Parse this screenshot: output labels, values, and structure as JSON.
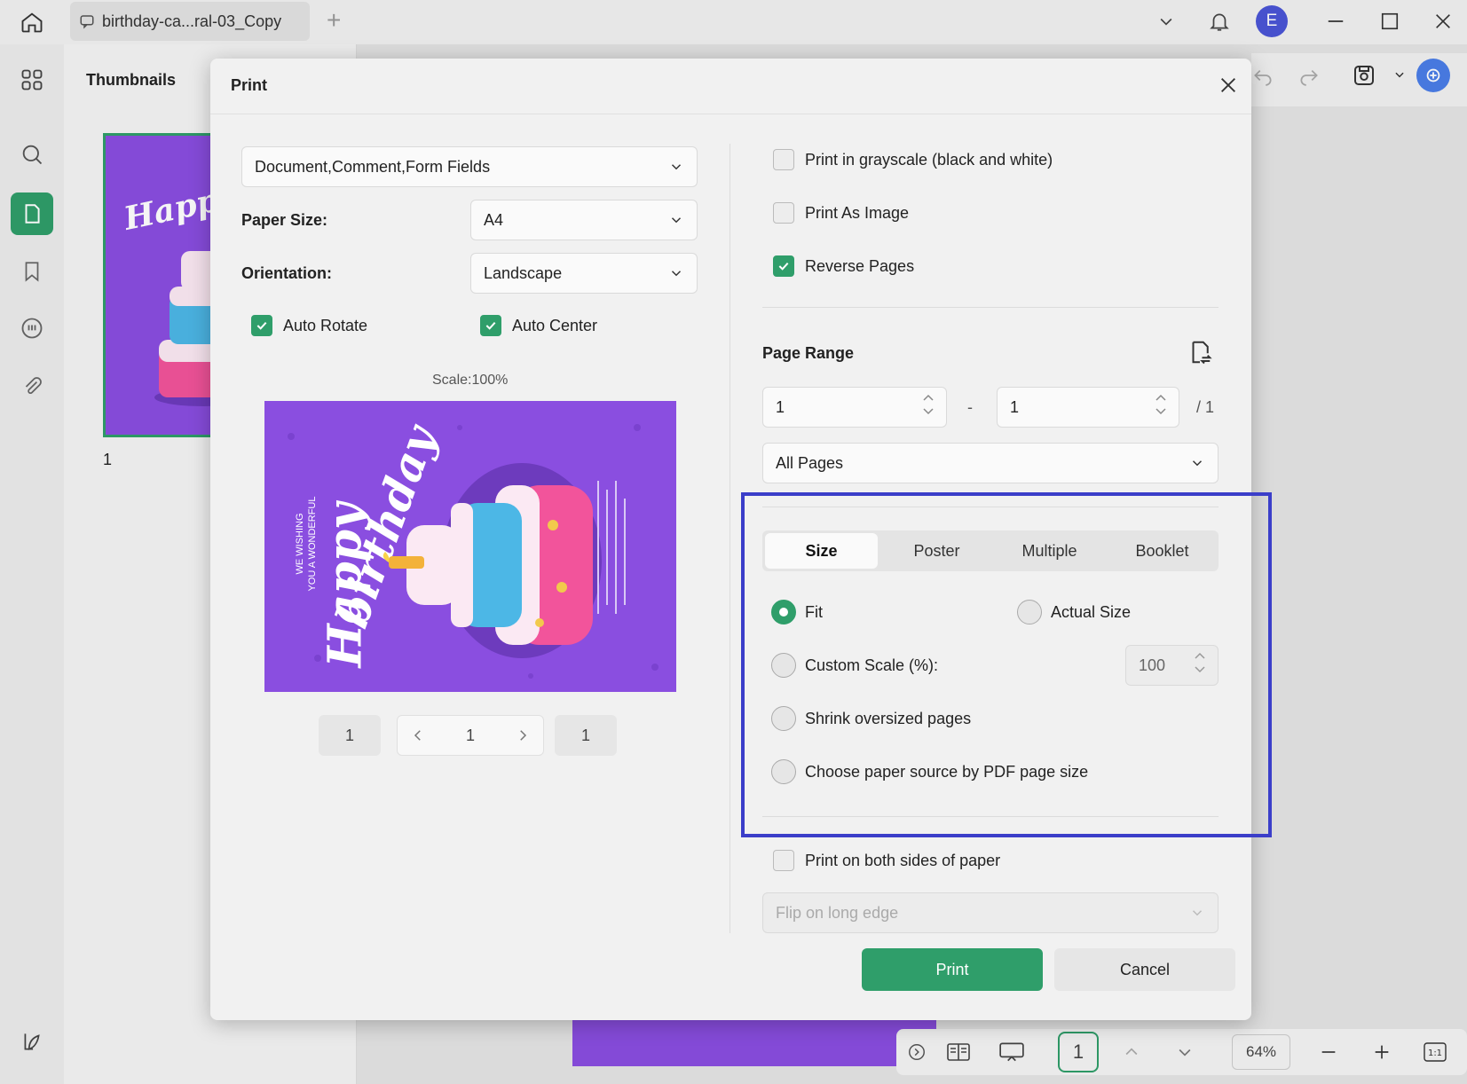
{
  "titlebar": {
    "tab_title": "birthday-ca...ral-03_Copy"
  },
  "user": {
    "avatar_initial": "E"
  },
  "thumbnails": {
    "title": "Thumbnails",
    "page_number": "1"
  },
  "bottom_bar": {
    "page": "1",
    "zoom": "64%"
  },
  "dialog": {
    "title": "Print",
    "content_select": "Document,Comment,Form Fields",
    "paper_size_label": "Paper Size:",
    "paper_size_value": "A4",
    "orientation_label": "Orientation:",
    "orientation_value": "Landscape",
    "auto_rotate": "Auto Rotate",
    "auto_center": "Auto Center",
    "scale_text": "Scale:100%",
    "preview_nav": {
      "first": "1",
      "current": "1",
      "last": "1"
    },
    "grayscale": "Print in grayscale (black and white)",
    "print_as_image": "Print As Image",
    "reverse_pages": "Reverse Pages",
    "page_range_label": "Page Range",
    "range_from": "1",
    "range_sep": "-",
    "range_to": "1",
    "range_total": "/ 1",
    "pages_select": "All Pages",
    "tabs": [
      "Size",
      "Poster",
      "Multiple",
      "Booklet"
    ],
    "fit": "Fit",
    "actual_size": "Actual Size",
    "custom_scale": "Custom Scale (%):",
    "custom_scale_value": "100",
    "shrink": "Shrink oversized pages",
    "paper_source": "Choose paper source by PDF page size",
    "both_sides": "Print on both sides of paper",
    "flip_select": "Flip on long edge",
    "print_button": "Print",
    "cancel_button": "Cancel"
  },
  "preview_art": {
    "happy": "Happy",
    "birthday": "birthday",
    "wishing_1": "WE WISHING",
    "wishing_2": "YOU A WONDERFUL"
  },
  "colors": {
    "accent": "#2f9e6a",
    "highlight": "#3b3ec9",
    "card": "#8a4ee0"
  }
}
